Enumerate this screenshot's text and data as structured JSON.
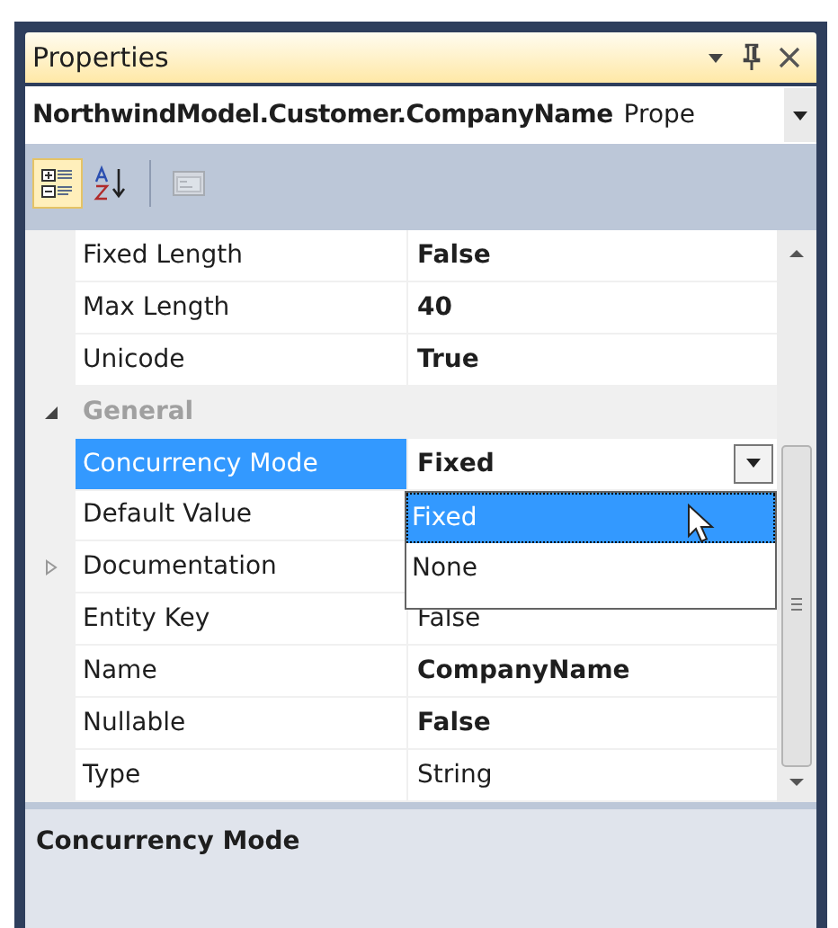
{
  "window": {
    "title": "Properties"
  },
  "object_selector": {
    "name": "NorthwindModel.Customer.CompanyName",
    "type": "Prope"
  },
  "toolbar": [
    {
      "kind": "categorized",
      "selected": true,
      "disabled": false
    },
    {
      "kind": "alphabetical",
      "selected": false,
      "disabled": false
    },
    {
      "kind": "property-pages",
      "selected": false,
      "disabled": true
    }
  ],
  "grid": {
    "rows": [
      {
        "kind": "property",
        "name": "Fixed Length",
        "value": "False",
        "bold": true,
        "selected": false
      },
      {
        "kind": "property",
        "name": "Max Length",
        "value": "40",
        "bold": true,
        "selected": false
      },
      {
        "kind": "property",
        "name": "Unicode",
        "value": "True",
        "bold": true,
        "selected": false
      },
      {
        "kind": "category",
        "name": "General",
        "expanded": true
      },
      {
        "kind": "property",
        "name": "Concurrency Mode",
        "value": "Fixed",
        "bold": true,
        "selected": true,
        "dropdown": {
          "open": true,
          "options": [
            {
              "label": "Fixed",
              "selected": true
            },
            {
              "label": "None",
              "selected": false
            }
          ]
        }
      },
      {
        "kind": "property",
        "name": "Default Value",
        "selected": false
      },
      {
        "kind": "property",
        "name": "Documentation",
        "selected": false,
        "expanded": false
      },
      {
        "kind": "property",
        "name": "Entity Key",
        "value": "False",
        "bold": false,
        "selected": false
      },
      {
        "kind": "property",
        "name": "Name",
        "value": "CompanyName",
        "bold": true,
        "selected": false
      },
      {
        "kind": "property",
        "name": "Nullable",
        "value": "False",
        "bold": true,
        "selected": false
      },
      {
        "kind": "property",
        "name": "Type",
        "value": "String",
        "bold": false,
        "selected": false
      }
    ]
  },
  "description": {
    "title": "Concurrency Mode"
  }
}
